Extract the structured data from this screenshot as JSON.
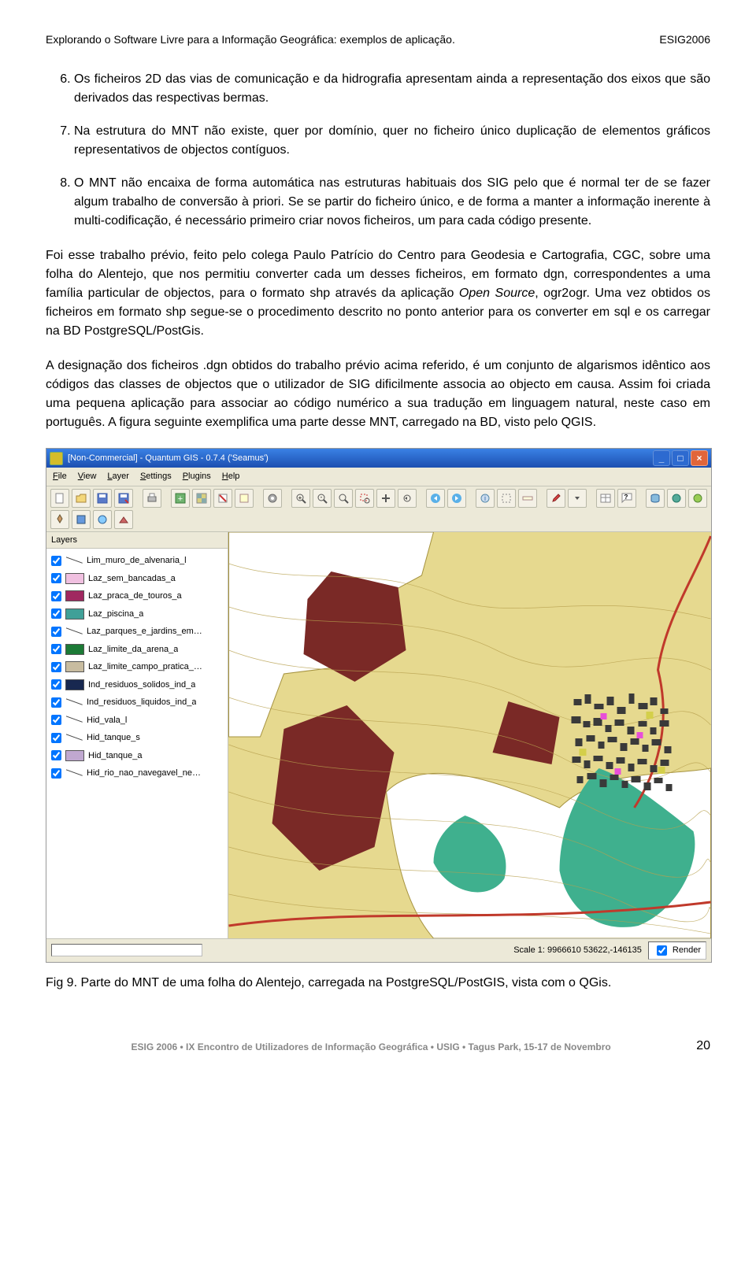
{
  "header": {
    "left": "Explorando o Software Livre para a Informação Geográfica: exemplos de aplicação.",
    "right": "ESIG2006"
  },
  "items": [
    "Os ficheiros 2D das vias de comunicação e da hidrografia apresentam ainda a representação dos eixos que são derivados das respectivas bermas.",
    "Na estrutura do MNT não existe, quer por domínio, quer no ficheiro único duplicação de elementos gráficos representativos de objectos contíguos.",
    "O MNT não encaixa de forma automática nas estruturas habituais dos SIG pelo que é normal ter de se fazer algum trabalho de conversão à priori. Se se partir do ficheiro único, e de forma a manter a informação inerente à multi-codificação, é necessário primeiro criar novos ficheiros, um para cada código presente."
  ],
  "para1_a": "Foi esse trabalho prévio, feito pelo colega Paulo Patrício do Centro para Geodesia e Cartografia, CGC, sobre uma folha do Alentejo, que nos permitiu converter cada um desses ficheiros, em formato dgn, correspondentes a uma família particular de objectos, para o formato shp através da aplicação ",
  "para1_em": "Open Source",
  "para1_b": ", ogr2ogr. Uma vez obtidos os ficheiros em formato shp segue-se o procedimento descrito no ponto anterior para os converter em sql e os carregar na BD PostgreSQL/PostGis.",
  "para2": "A designação dos ficheiros .dgn obtidos do trabalho prévio acima referido, é um conjunto de algarismos idêntico aos códigos das classes de objectos que o utilizador de SIG dificilmente associa ao objecto em causa. Assim foi criada uma pequena aplicação para associar ao código numérico a sua tradução em linguagem natural, neste caso em português. A figura seguinte exemplifica uma parte desse MNT, carregado na BD, visto pelo QGIS.",
  "app": {
    "title": "[Non-Commercial] - Quantum GIS - 0.7.4 ('Seamus')",
    "menu": [
      "File",
      "View",
      "Layer",
      "Settings",
      "Plugins",
      "Help"
    ],
    "layers_header": "Layers",
    "layers": [
      {
        "style": "line",
        "name": "Lim_muro_de_alvenaria_l"
      },
      {
        "style": "swatch",
        "color": "#f0c0e0",
        "name": "Laz_sem_bancadas_a"
      },
      {
        "style": "swatch",
        "color": "#a02860",
        "name": "Laz_praca_de_touros_a"
      },
      {
        "style": "swatch",
        "color": "#40a098",
        "name": "Laz_piscina_a"
      },
      {
        "style": "line",
        "name": "Laz_parques_e_jardins_em_geral"
      },
      {
        "style": "swatch",
        "color": "#1c7a36",
        "name": "Laz_limite_da_arena_a"
      },
      {
        "style": "swatch",
        "color": "#c8bca0",
        "name": "Laz_limite_campo_pratica_despo"
      },
      {
        "style": "swatch",
        "color": "#182850",
        "name": "Ind_residuos_solidos_ind_a"
      },
      {
        "style": "line",
        "name": "Ind_residuos_liquidos_ind_a"
      },
      {
        "style": "line",
        "name": "Hid_vala_l"
      },
      {
        "style": "line",
        "name": "Hid_tanque_s"
      },
      {
        "style": "swatch",
        "color": "#c0a8d0",
        "name": "Hid_tanque_a"
      },
      {
        "style": "line",
        "name": "Hid_rio_nao_navegavel_nem_flutu"
      }
    ],
    "scale": "Scale 1: 9966610  53622,-146135",
    "render": "Render"
  },
  "caption": "Fig 9. Parte do MNT de uma folha do Alentejo, carregada na PostgreSQL/PostGIS, vista com o QGis.",
  "footer": {
    "text": "ESIG 2006 • IX Encontro de Utilizadores de Informação Geográfica • USIG • Tagus Park, 15-17 de Novembro",
    "page": "20"
  }
}
